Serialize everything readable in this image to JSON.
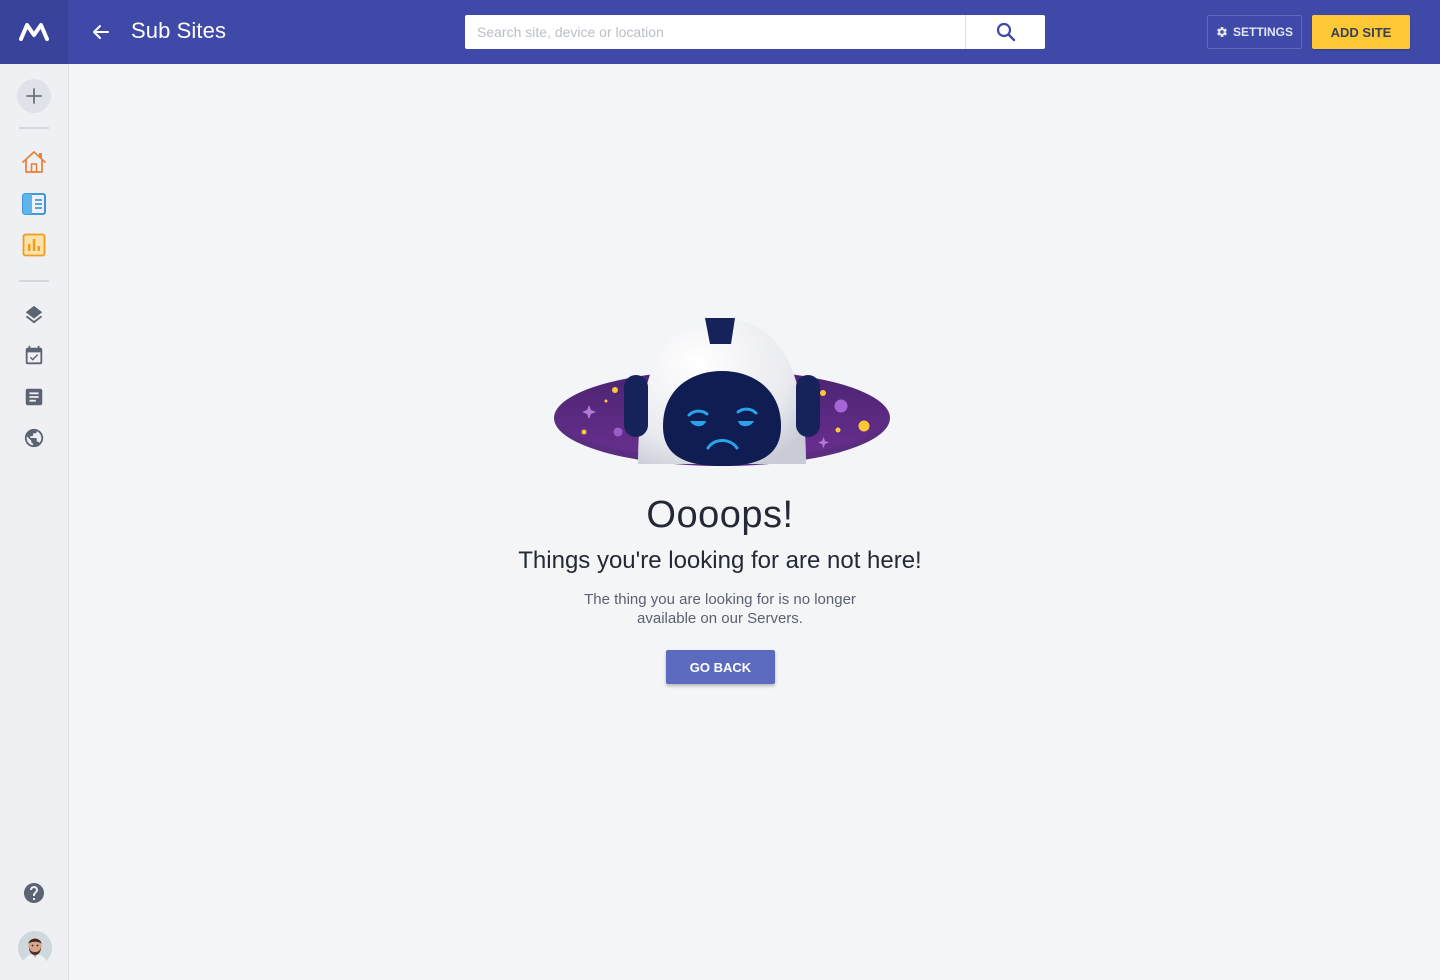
{
  "header": {
    "title": "Sub Sites",
    "search_placeholder": "Search site, device or location",
    "settings_label": "SETTINGS",
    "add_site_label": "ADD SITE"
  },
  "sidebar": {
    "items": [
      {
        "icon": "plus-icon"
      },
      {
        "icon": "home-icon"
      },
      {
        "icon": "sites-icon"
      },
      {
        "icon": "reports-icon"
      },
      {
        "icon": "layers-icon"
      },
      {
        "icon": "calendar-check-icon"
      },
      {
        "icon": "document-icon"
      },
      {
        "icon": "globe-icon"
      },
      {
        "icon": "help-icon"
      }
    ]
  },
  "error": {
    "heading": "Oooops!",
    "subheading": "Things you're looking for are not here!",
    "description": "The thing you are looking for is no longer available on our Servers.",
    "button_label": "GO BACK"
  },
  "colors": {
    "header_bg": "#3f4aa8",
    "accent_yellow": "#fcc934",
    "button_primary": "#5c6bc0",
    "page_bg": "#f3f5f7"
  }
}
